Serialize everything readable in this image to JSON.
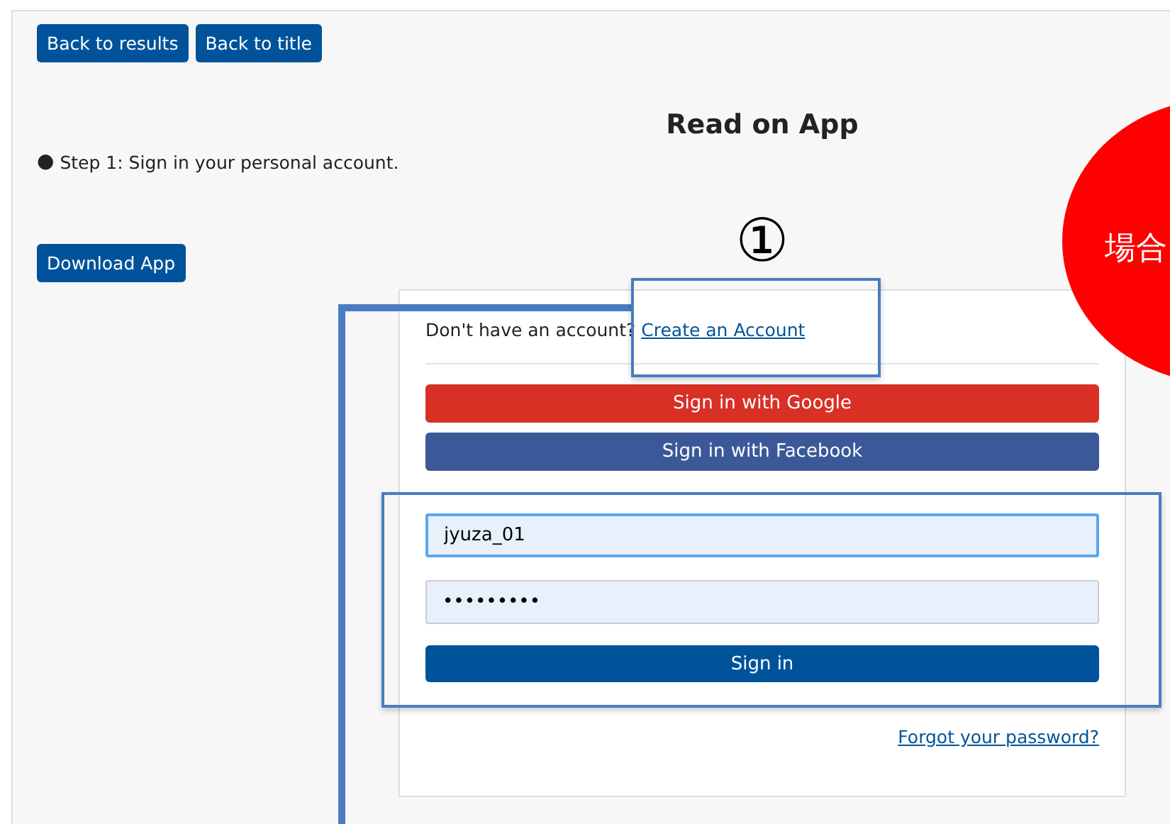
{
  "nav_buttons": [
    "Back to results",
    "Back to title"
  ],
  "title": "Read on App",
  "step": {
    "marker": "●",
    "text": "Step 1: Sign in your personal account."
  },
  "download_button": "Download App",
  "annotation_number": "①",
  "signup": {
    "prompt": "Don't have an account?",
    "link": "Create an Account"
  },
  "social_buttons": [
    {
      "kind": "google",
      "label": "Sign in with Google"
    },
    {
      "kind": "facebook",
      "label": "Sign in with Facebook"
    }
  ],
  "username": {
    "value": "jyuza_01",
    "focused": true
  },
  "password": {
    "value": "•••••••••",
    "focused": false
  },
  "sign_in_button": "Sign in",
  "forgot_link": "Forgot your password?",
  "callout": {
    "text": "場合"
  }
}
